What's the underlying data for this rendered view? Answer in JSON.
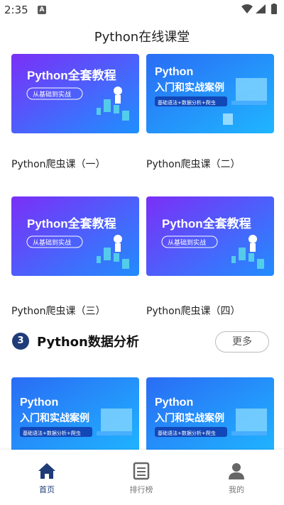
{
  "status": {
    "time": "2:35",
    "notification_letter": "A"
  },
  "header": {
    "title": "Python在线课堂"
  },
  "cards": [
    {
      "title": "Python爬虫课（一）",
      "banner": "full-course",
      "banner_title": "Python全套教程",
      "banner_tag": "从基础到实战"
    },
    {
      "title": "Python爬虫课（二）",
      "banner": "intro-cases",
      "banner_title_1": "Python",
      "banner_title_2": "入门和实战案例",
      "banner_tag": "基础语法+数据分析+爬虫"
    },
    {
      "title": "Python爬虫课（三）",
      "banner": "full-course",
      "banner_title": "Python全套教程",
      "banner_tag": "从基础到实战"
    },
    {
      "title": "Python爬虫课（四）",
      "banner": "full-course",
      "banner_title": "Python全套教程",
      "banner_tag": "从基础到实战"
    },
    {
      "title": "",
      "banner": "intro-cases",
      "banner_title_1": "Python",
      "banner_title_2": "入门和实战案例",
      "banner_tag": "基础语法+数据分析+爬虫"
    },
    {
      "title": "",
      "banner": "intro-cases",
      "banner_title_1": "Python",
      "banner_title_2": "入门和实战案例",
      "banner_tag": "基础语法+数据分析+爬虫"
    }
  ],
  "section": {
    "number": "3",
    "title": "Python数据分析",
    "more_label": "更多"
  },
  "nav": [
    {
      "label": "首页",
      "icon": "home-icon",
      "active": true
    },
    {
      "label": "排行榜",
      "icon": "list-icon",
      "active": false
    },
    {
      "label": "我的",
      "icon": "person-icon",
      "active": false
    }
  ],
  "colors": {
    "accent": "#1f3b78",
    "purple_banner": "#7a3cf0",
    "blue_banner": "#1e6cf0"
  }
}
